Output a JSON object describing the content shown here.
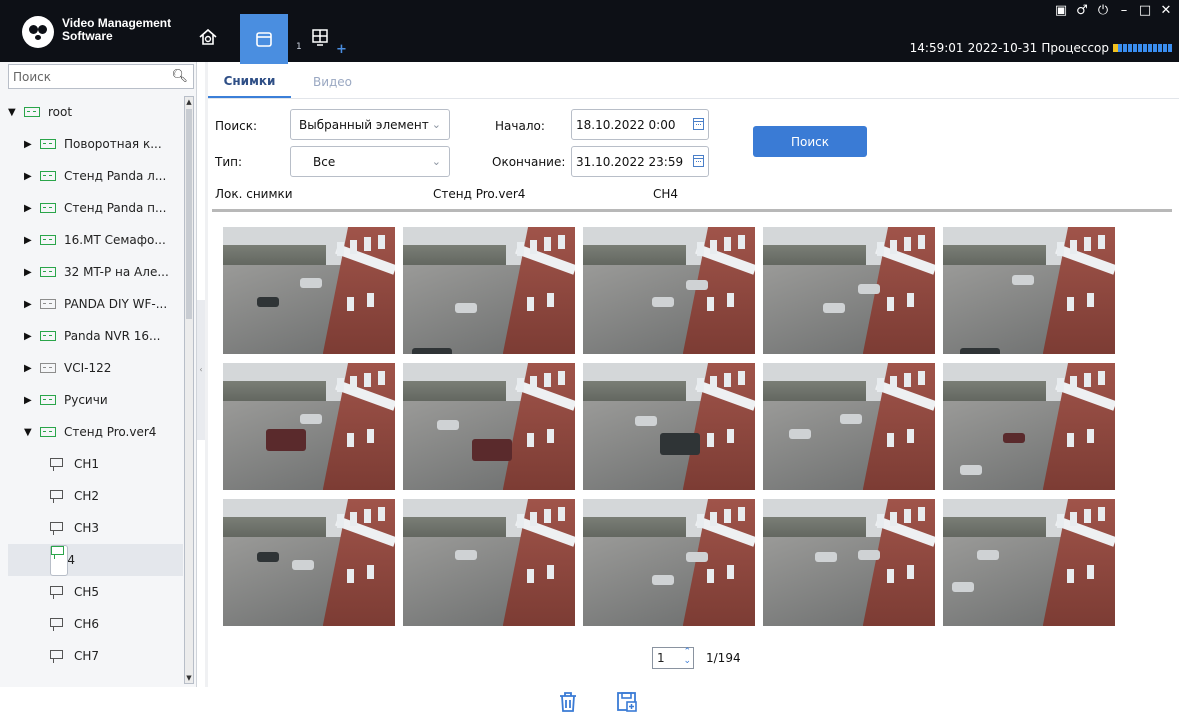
{
  "app": {
    "name_line1": "Video Management",
    "name_line2": "Software"
  },
  "nav": {
    "count": "1",
    "plus": "+"
  },
  "window_controls": [
    "▣",
    "♂",
    "⏻",
    "–",
    "□",
    "✕"
  ],
  "status": {
    "time": "14:59:01",
    "date": "2022-10-31",
    "cpu_label": "Процессор"
  },
  "sidebar": {
    "search_placeholder": "Поиск",
    "tree": [
      {
        "label": "root",
        "expanded": true,
        "level": 0,
        "icon": "device-icon",
        "online": true
      },
      {
        "label": "Поворотная к...",
        "level": 1,
        "icon": "device-icon",
        "online": true
      },
      {
        "label": "Стенд Panda л...",
        "level": 1,
        "icon": "device-icon",
        "online": true
      },
      {
        "label": "Стенд Panda п...",
        "level": 1,
        "icon": "device-icon",
        "online": true
      },
      {
        "label": "16.MT Семафо...",
        "level": 1,
        "icon": "device-icon",
        "online": true
      },
      {
        "label": "32 MT-P на Але...",
        "level": 1,
        "icon": "device-icon",
        "online": true
      },
      {
        "label": "PANDA DIY WF-...",
        "level": 1,
        "icon": "device-icon",
        "online": false
      },
      {
        "label": "Panda NVR 16...",
        "level": 1,
        "icon": "device-icon",
        "online": true
      },
      {
        "label": "VCI-122",
        "level": 1,
        "icon": "device-icon",
        "online": false
      },
      {
        "label": "Русичи",
        "level": 1,
        "icon": "device-icon",
        "online": true
      },
      {
        "label": "Стенд Pro.ver4",
        "level": 1,
        "icon": "device-icon",
        "online": true,
        "expanded": true
      },
      {
        "label": "CH1",
        "level": 2,
        "icon": "camera-icon"
      },
      {
        "label": "CH2",
        "level": 2,
        "icon": "camera-icon"
      },
      {
        "label": "CH3",
        "level": 2,
        "icon": "camera-icon"
      },
      {
        "label": "CH4",
        "level": 2,
        "icon": "camera-icon",
        "selected": true
      },
      {
        "label": "CH5",
        "level": 2,
        "icon": "camera-icon"
      },
      {
        "label": "CH6",
        "level": 2,
        "icon": "camera-icon"
      },
      {
        "label": "CH7",
        "level": 2,
        "icon": "camera-icon"
      }
    ]
  },
  "tabs": [
    {
      "label": "Снимки",
      "active": true
    },
    {
      "label": "Видео",
      "active": false
    }
  ],
  "filters": {
    "search_label": "Поиск:",
    "search_value": "Выбранный элемент",
    "type_label": "Тип:",
    "type_value": "Все",
    "start_label": "Начало:",
    "start_value": "18.10.2022 0:00",
    "end_label": "Окончание:",
    "end_value": "31.10.2022 23:59",
    "search_button": "Поиск"
  },
  "info": {
    "source": "Лок. снимки",
    "device": "Стенд Pro.ver4",
    "channel": "CH4"
  },
  "thumbnails_count": 15,
  "pager": {
    "current": "1",
    "total": "1/194"
  },
  "colors": {
    "accent": "#3a7bd5",
    "titlebar": "#0d1016",
    "online": "#2aa54a"
  },
  "toolbar_icons": [
    "trash-icon",
    "save-icon"
  ]
}
